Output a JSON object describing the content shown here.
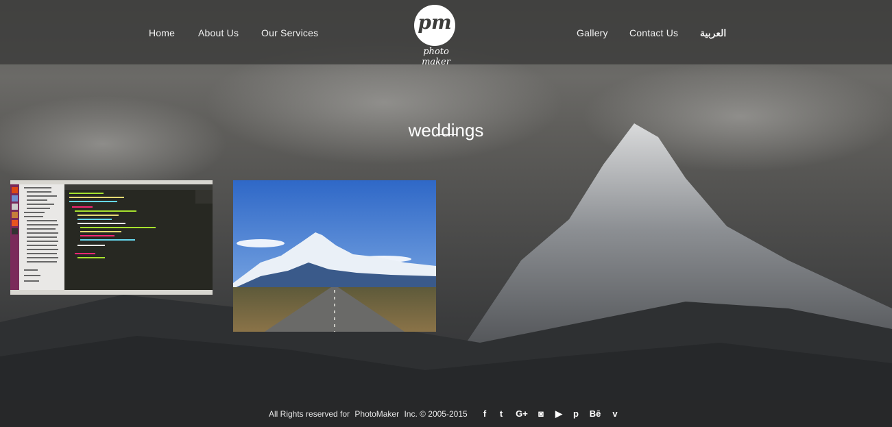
{
  "nav": {
    "left": [
      "Home",
      "About Us",
      "Our Services"
    ],
    "right": [
      "Gallery",
      "Contact Us",
      "العربية"
    ]
  },
  "logo": {
    "mark": "pm",
    "text": "photo maker"
  },
  "page": {
    "title": "weddings"
  },
  "gallery": [
    {
      "icon": "code-editor-screenshot-thumbnail"
    },
    {
      "icon": "mountain-road-thumbnail"
    }
  ],
  "footer": {
    "rights": "All Rights reserved for",
    "brand": "PhotoMaker",
    "copyright": "Inc. © 2005-2015",
    "social": [
      {
        "icon": "facebook-icon",
        "glyph": "f"
      },
      {
        "icon": "twitter-icon",
        "glyph": "t"
      },
      {
        "icon": "google-plus-icon",
        "glyph": "G+"
      },
      {
        "icon": "instagram-icon",
        "glyph": "◙"
      },
      {
        "icon": "youtube-icon",
        "glyph": "▶"
      },
      {
        "icon": "pinterest-icon",
        "glyph": "p"
      },
      {
        "icon": "behance-icon",
        "glyph": "Bē"
      },
      {
        "icon": "vimeo-icon",
        "glyph": "v"
      }
    ]
  }
}
